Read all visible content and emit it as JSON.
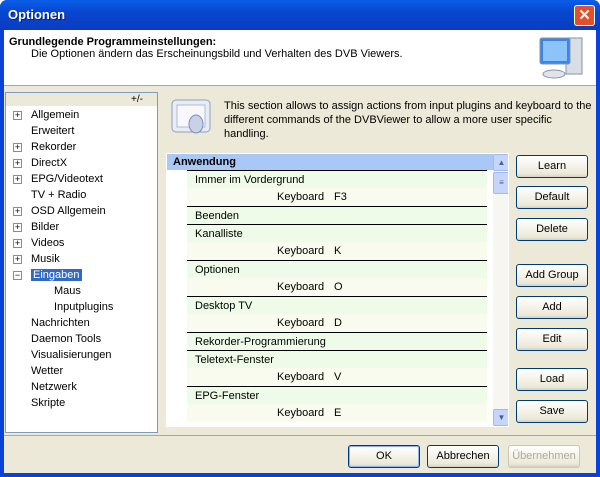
{
  "window": {
    "title": "Optionen"
  },
  "header": {
    "title": "Grundlegende Programmeinstellungen:",
    "subtitle": "Die Optionen ändern das Erscheinungsbild und Verhalten des DVB Viewers."
  },
  "tree": {
    "toggle": "+/-",
    "items": [
      {
        "label": "Allgemein",
        "exp": "+"
      },
      {
        "label": "Erweitert",
        "exp": ""
      },
      {
        "label": "Rekorder",
        "exp": "+"
      },
      {
        "label": "DirectX",
        "exp": "+"
      },
      {
        "label": "EPG/Videotext",
        "exp": "+"
      },
      {
        "label": "TV + Radio",
        "exp": ""
      },
      {
        "label": "OSD Allgemein",
        "exp": "+"
      },
      {
        "label": "Bilder",
        "exp": "+"
      },
      {
        "label": "Videos",
        "exp": "+"
      },
      {
        "label": "Musik",
        "exp": "+"
      },
      {
        "label": "Eingaben",
        "exp": "-",
        "selected": true
      },
      {
        "label": "Maus",
        "child": true
      },
      {
        "label": "Inputplugins",
        "child": true
      },
      {
        "label": "Nachrichten",
        "exp": ""
      },
      {
        "label": "Daemon Tools",
        "exp": ""
      },
      {
        "label": "Visualisierungen",
        "exp": ""
      },
      {
        "label": "Wetter",
        "exp": ""
      },
      {
        "label": "Netzwerk",
        "exp": ""
      },
      {
        "label": "Skripte",
        "exp": ""
      }
    ]
  },
  "info": "This section allows to assign actions from input plugins and keyboard to the different commands of the DVBViewer to allow a more user specific handling.",
  "list": {
    "group": "Anwendung",
    "rows": [
      {
        "name": "Immer im Vordergrund",
        "device": "Keyboard",
        "key": "F3"
      },
      {
        "name": "Beenden"
      },
      {
        "name": "Kanalliste",
        "device": "Keyboard",
        "key": "K"
      },
      {
        "name": "Optionen",
        "device": "Keyboard",
        "key": "O"
      },
      {
        "name": "Desktop TV",
        "device": "Keyboard",
        "key": "D"
      },
      {
        "name": "Rekorder-Programmierung"
      },
      {
        "name": "Teletext-Fenster",
        "device": "Keyboard",
        "key": "V"
      },
      {
        "name": "EPG-Fenster",
        "device": "Keyboard",
        "key": "E"
      }
    ]
  },
  "buttons": {
    "learn": "Learn",
    "default": "Default",
    "delete": "Delete",
    "add_group": "Add Group",
    "add": "Add",
    "edit": "Edit",
    "load": "Load",
    "save": "Save"
  },
  "footer": {
    "ok": "OK",
    "cancel": "Abbrechen",
    "apply": "Übernehmen"
  }
}
